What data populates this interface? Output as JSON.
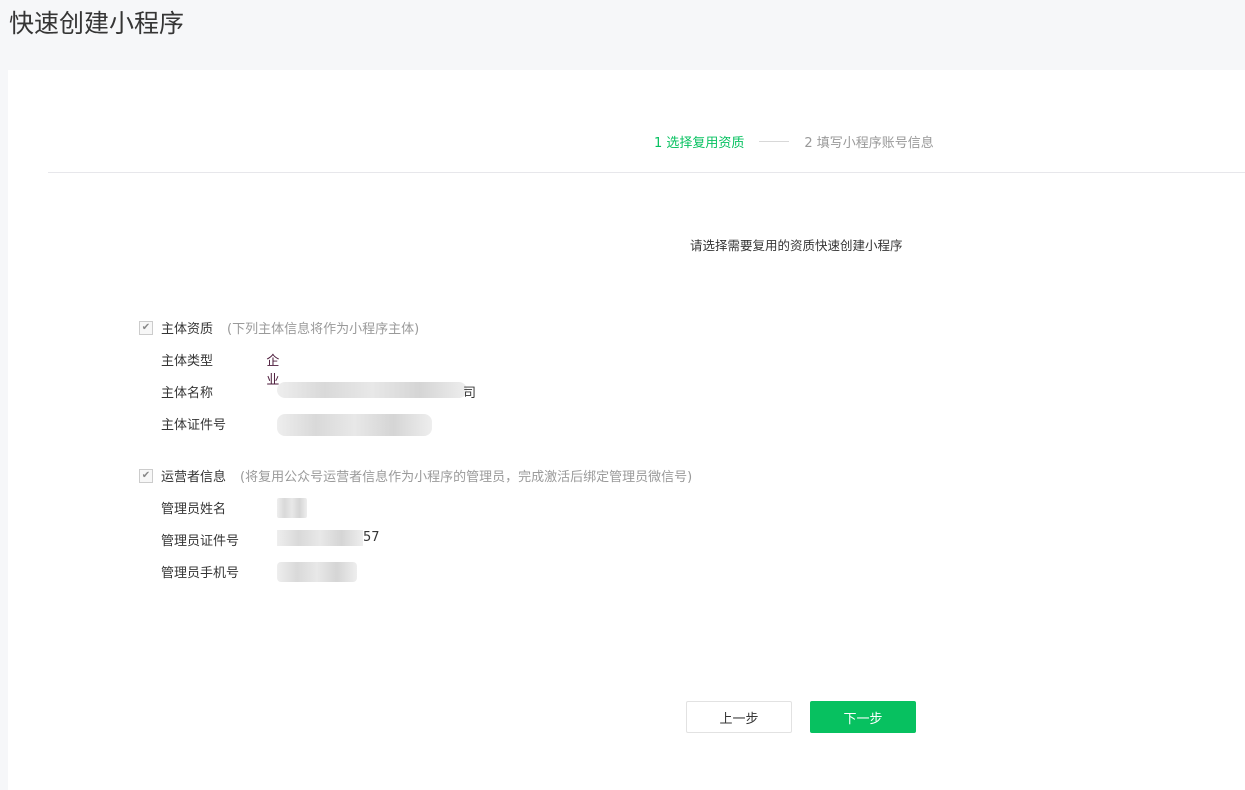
{
  "page_title": "快速创建小程序",
  "steps": [
    {
      "label": "1 选择复用资质"
    },
    {
      "label": "2 填写小程序账号信息"
    }
  ],
  "prompt": "请选择需要复用的资质快速创建小程序",
  "entity": {
    "label": "主体资质",
    "hint": "(下列主体信息将作为小程序主体)",
    "checked": true,
    "fields": [
      {
        "label": "主体类型",
        "value": "企业"
      },
      {
        "label": "主体名称",
        "value": "司"
      },
      {
        "label": "主体证件号",
        "value": ""
      }
    ]
  },
  "operator": {
    "label": "运营者信息",
    "hint": "(将复用公众号运营者信息作为小程序的管理员，完成激活后绑定管理员微信号)",
    "checked": true,
    "fields": [
      {
        "label": "管理员姓名",
        "value": ""
      },
      {
        "label": "管理员证件号",
        "value": "57"
      },
      {
        "label": "管理员手机号",
        "value": ""
      }
    ]
  },
  "buttons": {
    "prev": "上一步",
    "next": "下一步"
  },
  "colors": {
    "accent": "#07c160"
  }
}
